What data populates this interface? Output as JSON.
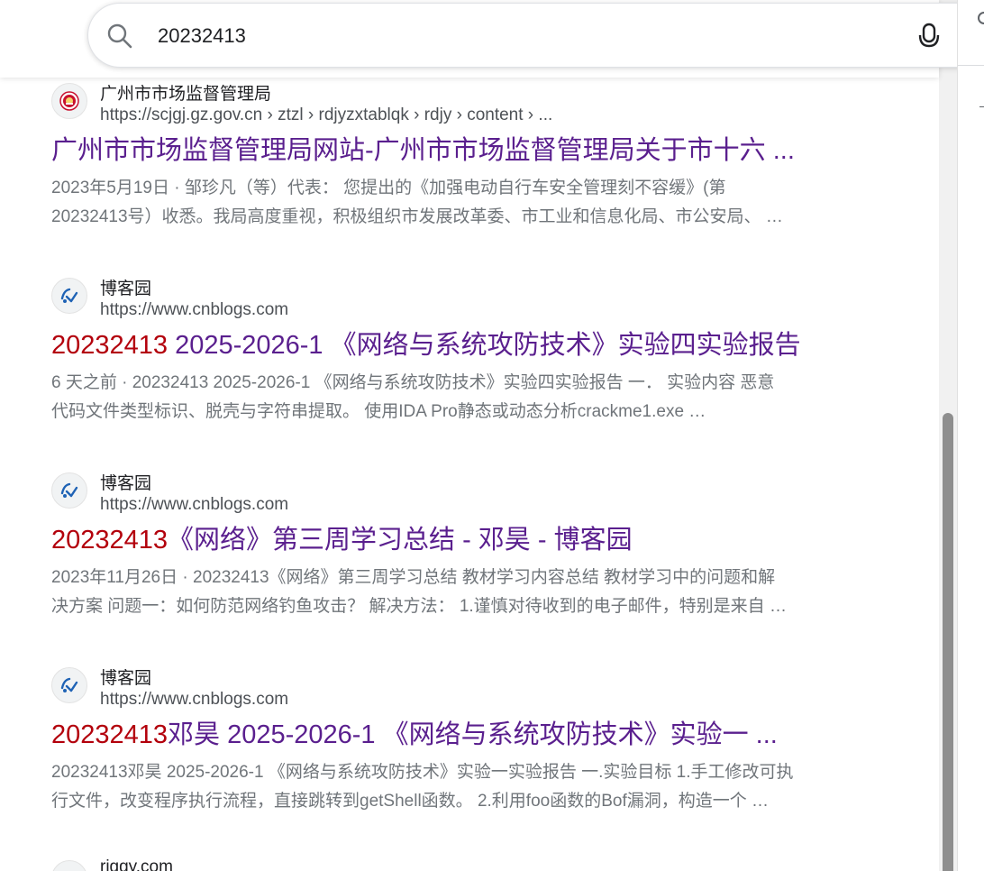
{
  "search": {
    "query": "20232413"
  },
  "results": [
    {
      "site_name": "广州市市场监督管理局",
      "url": "https://scjgj.gz.gov.cn › ztzl › rdjyzxtablqk › rdjy › content › ...",
      "title_highlight": "",
      "title_rest": "广州市市场监督管理局网站-广州市市场监督管理局关于市十六 ...",
      "snippet_line1": "2023年5月19日 · 邹珍凡（等）代表： 您提出的《加强电动自行车安全管理刻不容缓》(第",
      "snippet_line2": "20232413号）收悉。我局高度重视，积极组织市发展改革委、市工业和信息化局、市公安局、 …"
    },
    {
      "site_name": "博客园",
      "url": "https://www.cnblogs.com",
      "title_highlight": "20232413",
      "title_rest": " 2025-2026-1 《网络与系统攻防技术》实验四实验报告",
      "snippet_line1": "6 天之前 · 20232413 2025-2026-1 《网络与系统攻防技术》实验四实验报告 一． 实验内容 恶意",
      "snippet_line2": "代码文件类型标识、脱壳与字符串提取。 使用IDA Pro静态或动态分析crackme1.exe …"
    },
    {
      "site_name": "博客园",
      "url": "https://www.cnblogs.com",
      "title_highlight": "20232413",
      "title_rest": "《网络》第三周学习总结 - 邓昊 - 博客园",
      "snippet_line1": "2023年11月26日 · 20232413《网络》第三周学习总结 教材学习内容总结 教材学习中的问题和解",
      "snippet_line2": "决方案 问题一：如何防范网络钓鱼攻击？ 解决方法： 1.谨慎对待收到的电子邮件，特别是来自 …"
    },
    {
      "site_name": "博客园",
      "url": "https://www.cnblogs.com",
      "title_highlight": "20232413",
      "title_rest": "邓昊 2025-2026-1 《网络与系统攻防技术》实验一 ...",
      "snippet_line1": "20232413邓昊 2025-2026-1 《网络与系统攻防技术》实验一实验报告 一.实验目标 1.手工修改可执",
      "snippet_line2": "行文件，改变程序执行流程，直接跳转到getShell函数。 2.利用foo函数的Bof漏洞，构造一个 …"
    },
    {
      "site_name": "riggy.com",
      "url": "",
      "title_highlight": "",
      "title_rest": "",
      "snippet_line1": "",
      "snippet_line2": ""
    }
  ],
  "colors": {
    "title_visited": "#5a1f8e",
    "title_highlight": "#b3000c",
    "snippet": "#70757a"
  },
  "icons": {
    "search": "search-icon",
    "mic": "microphone-icon",
    "gov_favicon": "gov-emblem-icon",
    "cnblogs_favicon": "cnblogs-logo-icon"
  }
}
